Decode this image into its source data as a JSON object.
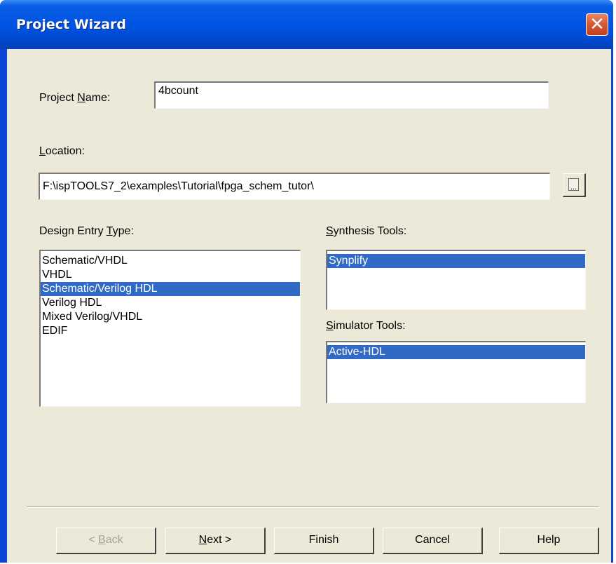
{
  "window": {
    "title": "Project Wizard",
    "close_icon": "close-icon",
    "close_glyph": "✕"
  },
  "form": {
    "project_name": {
      "label_pre": "Project ",
      "label_key": "N",
      "label_post": "ame:",
      "value": "4bcount"
    },
    "location": {
      "label_pre": "",
      "label_key": "L",
      "label_post": "ocation:",
      "value": "F:\\ispTOOLS7_2\\examples\\Tutorial\\fpga_schem_tutor\\",
      "browse_label": "..."
    },
    "design_entry": {
      "label_pre": "Design Entry ",
      "label_key": "T",
      "label_post": "ype:",
      "items": [
        "Schematic/VHDL",
        "VHDL",
        "Schematic/Verilog HDL",
        "Verilog HDL",
        "Mixed Verilog/VHDL",
        "EDIF"
      ],
      "selected": "Schematic/Verilog HDL"
    },
    "synthesis": {
      "label_pre": "",
      "label_key": "S",
      "label_post": "ynthesis Tools:",
      "items": [
        "Synplify"
      ],
      "selected": "Synplify"
    },
    "simulator": {
      "label_pre": "",
      "label_key": "S",
      "label_post": "imulator Tools:",
      "items": [
        "Active-HDL"
      ],
      "selected": "Active-HDL"
    }
  },
  "buttons": {
    "back": {
      "pre": "< ",
      "key": "B",
      "post": "ack",
      "enabled": false
    },
    "next": {
      "pre": "",
      "key": "N",
      "post": "ext >",
      "enabled": true
    },
    "finish": {
      "label": "Finish"
    },
    "cancel": {
      "label": "Cancel"
    },
    "help": {
      "label": "Help"
    }
  },
  "colors": {
    "titlebar": "#0054e3",
    "face": "#ece9d8",
    "selection": "#316ac5",
    "close": "#d95a37"
  }
}
